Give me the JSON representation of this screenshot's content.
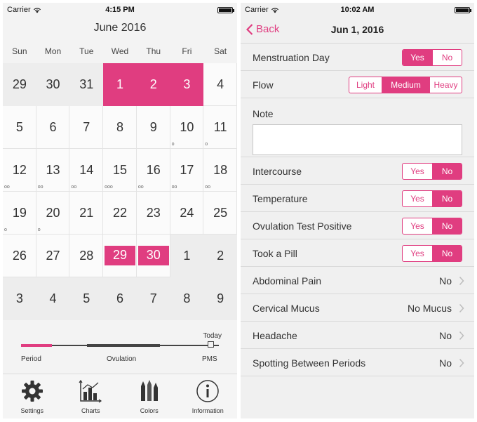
{
  "left": {
    "status": {
      "carrier": "Carrier",
      "time": "4:15 PM"
    },
    "month_title": "June 2016",
    "weekdays": [
      "Sun",
      "Mon",
      "Tue",
      "Wed",
      "Thu",
      "Fri",
      "Sat"
    ],
    "days": [
      {
        "n": "29",
        "t": "other"
      },
      {
        "n": "30",
        "t": "other"
      },
      {
        "n": "31",
        "t": "other"
      },
      {
        "n": "1",
        "t": "period"
      },
      {
        "n": "2",
        "t": "period"
      },
      {
        "n": "3",
        "t": "period"
      },
      {
        "n": "4",
        "t": "cur"
      },
      {
        "n": "5",
        "t": "cur"
      },
      {
        "n": "6",
        "t": "cur"
      },
      {
        "n": "7",
        "t": "cur"
      },
      {
        "n": "8",
        "t": "cur"
      },
      {
        "n": "9",
        "t": "cur"
      },
      {
        "n": "10",
        "t": "cur",
        "d": "o"
      },
      {
        "n": "11",
        "t": "cur",
        "d": "o"
      },
      {
        "n": "12",
        "t": "cur",
        "d": "oo"
      },
      {
        "n": "13",
        "t": "cur",
        "d": "oo"
      },
      {
        "n": "14",
        "t": "cur",
        "d": "oo"
      },
      {
        "n": "15",
        "t": "cur",
        "d": "ooo"
      },
      {
        "n": "16",
        "t": "cur",
        "d": "oo"
      },
      {
        "n": "17",
        "t": "cur",
        "d": "oo"
      },
      {
        "n": "18",
        "t": "cur",
        "d": "oo"
      },
      {
        "n": "19",
        "t": "cur",
        "d": "o"
      },
      {
        "n": "20",
        "t": "cur",
        "d": "o"
      },
      {
        "n": "21",
        "t": "cur"
      },
      {
        "n": "22",
        "t": "cur"
      },
      {
        "n": "23",
        "t": "cur"
      },
      {
        "n": "24",
        "t": "cur"
      },
      {
        "n": "25",
        "t": "cur"
      },
      {
        "n": "26",
        "t": "cur"
      },
      {
        "n": "27",
        "t": "cur"
      },
      {
        "n": "28",
        "t": "cur"
      },
      {
        "n": "29",
        "t": "strip"
      },
      {
        "n": "30",
        "t": "strip"
      },
      {
        "n": "1",
        "t": "other"
      },
      {
        "n": "2",
        "t": "other"
      },
      {
        "n": "3",
        "t": "other"
      },
      {
        "n": "4",
        "t": "other"
      },
      {
        "n": "5",
        "t": "other"
      },
      {
        "n": "6",
        "t": "other"
      },
      {
        "n": "7",
        "t": "other"
      },
      {
        "n": "8",
        "t": "other"
      },
      {
        "n": "9",
        "t": "other"
      }
    ],
    "legend": {
      "today": "Today",
      "period": "Period",
      "ovulation": "Ovulation",
      "pms": "PMS"
    },
    "tabs": [
      {
        "label": "Settings",
        "icon": "gear-icon"
      },
      {
        "label": "Charts",
        "icon": "bar-chart-icon"
      },
      {
        "label": "Colors",
        "icon": "colors-icon"
      },
      {
        "label": "Information",
        "icon": "info-icon"
      }
    ]
  },
  "right": {
    "status": {
      "carrier": "Carrier",
      "time": "10:02 AM"
    },
    "back_label": "Back",
    "title": "Jun 1, 2016",
    "menstruation": {
      "label": "Menstruation Day",
      "yes": "Yes",
      "no": "No",
      "selected": "Yes"
    },
    "flow": {
      "label": "Flow",
      "options": [
        "Light",
        "Medium",
        "Heavy"
      ],
      "selected": "Medium"
    },
    "note": {
      "label": "Note",
      "value": ""
    },
    "intercourse": {
      "label": "Intercourse",
      "yes": "Yes",
      "no": "No",
      "selected": "No"
    },
    "temperature": {
      "label": "Temperature",
      "yes": "Yes",
      "no": "No",
      "selected": "No"
    },
    "ovulation_test": {
      "label": "Ovulation Test Positive",
      "yes": "Yes",
      "no": "No",
      "selected": "No"
    },
    "pill": {
      "label": "Took a Pill",
      "yes": "Yes",
      "no": "No",
      "selected": "No"
    },
    "abdominal": {
      "label": "Abdominal Pain",
      "value": "No"
    },
    "mucus": {
      "label": "Cervical Mucus",
      "value": "No Mucus"
    },
    "headache": {
      "label": "Headache",
      "value": "No"
    },
    "spotting": {
      "label": "Spotting Between Periods",
      "value": "No"
    }
  },
  "colors": {
    "accent": "#e03d80"
  }
}
